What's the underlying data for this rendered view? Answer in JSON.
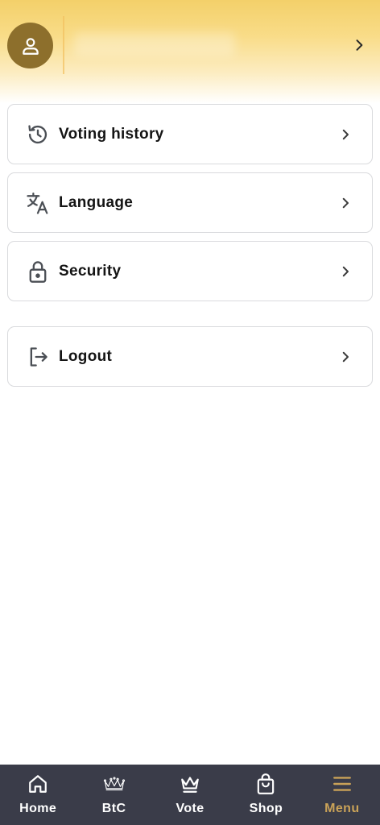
{
  "header": {
    "avatar_icon": "user-icon",
    "chevron_icon": "chevron-right-icon"
  },
  "menu": {
    "items": [
      {
        "label": "Voting history",
        "icon": "history-icon"
      },
      {
        "label": "Language",
        "icon": "translate-icon"
      },
      {
        "label": "Security",
        "icon": "lock-icon"
      },
      {
        "label": "Logout",
        "icon": "logout-icon"
      }
    ]
  },
  "bottom_nav": {
    "items": [
      {
        "label": "Home",
        "icon": "home-icon"
      },
      {
        "label": "BtC",
        "icon": "crown-jewel-icon"
      },
      {
        "label": "Vote",
        "icon": "crown-icon"
      },
      {
        "label": "Shop",
        "icon": "shopping-bag-icon"
      },
      {
        "label": "Menu",
        "icon": "hamburger-menu-icon"
      }
    ],
    "active": "Menu"
  },
  "colors": {
    "header_gold": "#f3d06a",
    "avatar_brown": "#8d6f2c",
    "nav_background": "#3a3c49",
    "nav_active": "#c9a258",
    "card_border": "#d9dadd"
  }
}
